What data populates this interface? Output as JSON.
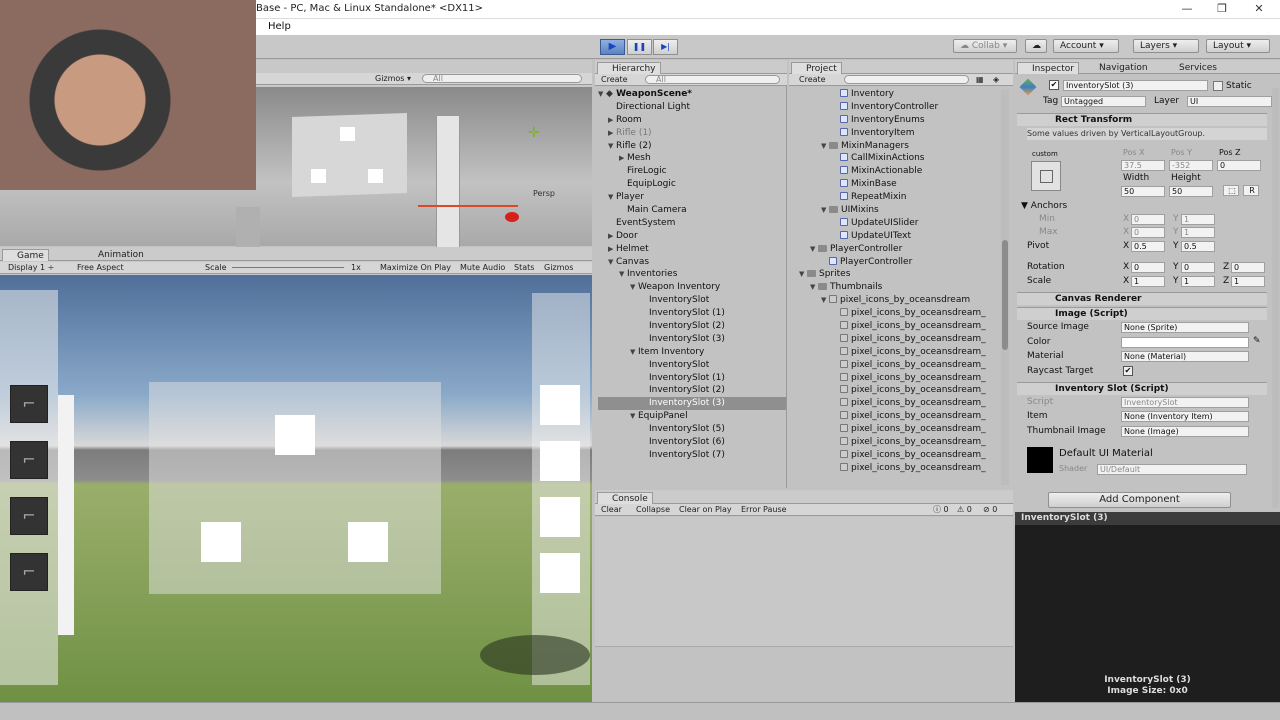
{
  "window": {
    "title": "Base - PC, Mac & Linux Standalone* <DX11>",
    "minimize": "—",
    "maximize": "❐",
    "close": "✕"
  },
  "menu": {
    "help": "Help"
  },
  "toolbar": {
    "collab": "Collab",
    "account": "Account",
    "layers": "Layers",
    "layout": "Layout",
    "play": "▶",
    "pause": "❚❚",
    "step": "▶|"
  },
  "scene": {
    "gizmos": "Gizmos",
    "search": "All",
    "persp": "Persp"
  },
  "game": {
    "tab": "Game",
    "tab2": "Animation",
    "display": "Display 1",
    "aspect": "Free Aspect",
    "scale_label": "Scale",
    "scale_value": "1x",
    "maximize": "Maximize On Play",
    "mute": "Mute Audio",
    "stats": "Stats",
    "gizmos": "Gizmos"
  },
  "hierarchy": {
    "tab": "Hierarchy",
    "create": "Create",
    "search": "All",
    "scene": "WeaponScene*",
    "items": [
      {
        "label": "Directional Light",
        "indent": 1,
        "tri": ""
      },
      {
        "label": "Room",
        "indent": 1,
        "tri": "▶"
      },
      {
        "label": "Rifle (1)",
        "indent": 1,
        "tri": "▶",
        "dim": true
      },
      {
        "label": "Rifle (2)",
        "indent": 1,
        "tri": "▼"
      },
      {
        "label": "Mesh",
        "indent": 2,
        "tri": "▶"
      },
      {
        "label": "FireLogic",
        "indent": 2,
        "tri": ""
      },
      {
        "label": "EquipLogic",
        "indent": 2,
        "tri": ""
      },
      {
        "label": "Player",
        "indent": 1,
        "tri": "▼"
      },
      {
        "label": "Main Camera",
        "indent": 2,
        "tri": ""
      },
      {
        "label": "EventSystem",
        "indent": 1,
        "tri": ""
      },
      {
        "label": "Door",
        "indent": 1,
        "tri": "▶"
      },
      {
        "label": "Helmet",
        "indent": 1,
        "tri": "▶"
      },
      {
        "label": "Canvas",
        "indent": 1,
        "tri": "▼"
      },
      {
        "label": "Inventories",
        "indent": 2,
        "tri": "▼"
      },
      {
        "label": "Weapon Inventory",
        "indent": 3,
        "tri": "▼"
      },
      {
        "label": "InventorySlot",
        "indent": 4,
        "tri": ""
      },
      {
        "label": "InventorySlot (1)",
        "indent": 4,
        "tri": ""
      },
      {
        "label": "InventorySlot (2)",
        "indent": 4,
        "tri": ""
      },
      {
        "label": "InventorySlot (3)",
        "indent": 4,
        "tri": ""
      },
      {
        "label": "Item Inventory",
        "indent": 3,
        "tri": "▼"
      },
      {
        "label": "InventorySlot",
        "indent": 4,
        "tri": ""
      },
      {
        "label": "InventorySlot (1)",
        "indent": 4,
        "tri": ""
      },
      {
        "label": "InventorySlot (2)",
        "indent": 4,
        "tri": ""
      },
      {
        "label": "InventorySlot (3)",
        "indent": 4,
        "tri": "",
        "sel": true
      },
      {
        "label": "EquipPanel",
        "indent": 3,
        "tri": "▼"
      },
      {
        "label": "InventorySlot (5)",
        "indent": 4,
        "tri": ""
      },
      {
        "label": "InventorySlot (6)",
        "indent": 4,
        "tri": ""
      },
      {
        "label": "InventorySlot (7)",
        "indent": 4,
        "tri": ""
      }
    ]
  },
  "project": {
    "tab": "Project",
    "create": "Create",
    "items": [
      {
        "label": "Inventory",
        "indent": 3,
        "kind": "script"
      },
      {
        "label": "InventoryController",
        "indent": 3,
        "kind": "script"
      },
      {
        "label": "InventoryEnums",
        "indent": 3,
        "kind": "script"
      },
      {
        "label": "InventoryItem",
        "indent": 3,
        "kind": "script"
      },
      {
        "label": "MixinManagers",
        "indent": 2,
        "kind": "folder",
        "tri": "▼"
      },
      {
        "label": "CallMixinActions",
        "indent": 3,
        "kind": "script"
      },
      {
        "label": "MixinActionable",
        "indent": 3,
        "kind": "script"
      },
      {
        "label": "MixinBase",
        "indent": 3,
        "kind": "script"
      },
      {
        "label": "RepeatMixin",
        "indent": 3,
        "kind": "script"
      },
      {
        "label": "UIMixins",
        "indent": 2,
        "kind": "folder",
        "tri": "▼"
      },
      {
        "label": "UpdateUISlider",
        "indent": 3,
        "kind": "script"
      },
      {
        "label": "UpdateUIText",
        "indent": 3,
        "kind": "script"
      },
      {
        "label": "PlayerController",
        "indent": 1,
        "kind": "folder",
        "tri": "▼"
      },
      {
        "label": "PlayerController",
        "indent": 2,
        "kind": "script"
      },
      {
        "label": "Sprites",
        "indent": 0,
        "kind": "folder",
        "tri": "▼"
      },
      {
        "label": "Thumbnails",
        "indent": 1,
        "kind": "folder",
        "tri": "▼"
      },
      {
        "label": "pixel_icons_by_oceansdream",
        "indent": 2,
        "kind": "sprite",
        "tri": "▼"
      },
      {
        "label": "pixel_icons_by_oceansdream_",
        "indent": 3,
        "kind": "sprite"
      },
      {
        "label": "pixel_icons_by_oceansdream_",
        "indent": 3,
        "kind": "sprite"
      },
      {
        "label": "pixel_icons_by_oceansdream_",
        "indent": 3,
        "kind": "sprite"
      },
      {
        "label": "pixel_icons_by_oceansdream_",
        "indent": 3,
        "kind": "sprite"
      },
      {
        "label": "pixel_icons_by_oceansdream_",
        "indent": 3,
        "kind": "sprite"
      },
      {
        "label": "pixel_icons_by_oceansdream_",
        "indent": 3,
        "kind": "sprite"
      },
      {
        "label": "pixel_icons_by_oceansdream_",
        "indent": 3,
        "kind": "sprite"
      },
      {
        "label": "pixel_icons_by_oceansdream_",
        "indent": 3,
        "kind": "sprite"
      },
      {
        "label": "pixel_icons_by_oceansdream_",
        "indent": 3,
        "kind": "sprite"
      },
      {
        "label": "pixel_icons_by_oceansdream_",
        "indent": 3,
        "kind": "sprite"
      },
      {
        "label": "pixel_icons_by_oceansdream_",
        "indent": 3,
        "kind": "sprite"
      },
      {
        "label": "pixel_icons_by_oceansdream_",
        "indent": 3,
        "kind": "sprite"
      },
      {
        "label": "pixel_icons_by_oceansdream_",
        "indent": 3,
        "kind": "sprite"
      }
    ]
  },
  "console": {
    "tab": "Console",
    "clear": "Clear",
    "collapse": "Collapse",
    "clear_on_play": "Clear on Play",
    "error_pause": "Error Pause",
    "info_count": "0",
    "warn_count": "0",
    "error_count": "0"
  },
  "inspector": {
    "tab": "Inspector",
    "tab2": "Navigation",
    "tab3": "Services",
    "object_name": "InventorySlot (3)",
    "static": "Static",
    "tag_label": "Tag",
    "tag": "Untagged",
    "layer_label": "Layer",
    "layer": "UI",
    "rect": {
      "title": "Rect Transform",
      "note": "Some values driven by VerticalLayoutGroup.",
      "custom": "custom",
      "posx_l": "Pos X",
      "posy_l": "Pos Y",
      "posz_l": "Pos Z",
      "posx": "37.5",
      "posy": "-352",
      "posz": "0",
      "width_l": "Width",
      "height_l": "Height",
      "width": "50",
      "height": "50",
      "anchors": "Anchors",
      "min": "Min",
      "max": "Max",
      "min_x": "0",
      "min_y": "1",
      "max_x": "0",
      "max_y": "1",
      "pivot": "Pivot",
      "pivot_x": "0.5",
      "pivot_y": "0.5",
      "rotation": "Rotation",
      "rot_x": "0",
      "rot_y": "0",
      "rot_z": "0",
      "scale": "Scale",
      "sc_x": "1",
      "sc_y": "1",
      "sc_z": "1",
      "x": "X",
      "y": "Y",
      "z": "Z",
      "r": "R"
    },
    "canvas_renderer": "Canvas Renderer",
    "image": {
      "title": "Image (Script)",
      "source_l": "Source Image",
      "source": "None (Sprite)",
      "color_l": "Color",
      "material_l": "Material",
      "material": "None (Material)",
      "raycast_l": "Raycast Target"
    },
    "slot": {
      "title": "Inventory Slot (Script)",
      "script_l": "Script",
      "script": "InventorySlot",
      "item_l": "Item",
      "item": "None (Inventory Item)",
      "thumb_l": "Thumbnail Image",
      "thumb": "None (Image)"
    },
    "material": {
      "name": "Default UI Material",
      "shader_l": "Shader",
      "shader": "UI/Default"
    },
    "add_component": "Add Component",
    "preview_title": "InventorySlot (3)",
    "preview_name": "InventorySlot (3)",
    "preview_size": "Image Size: 0x0"
  }
}
